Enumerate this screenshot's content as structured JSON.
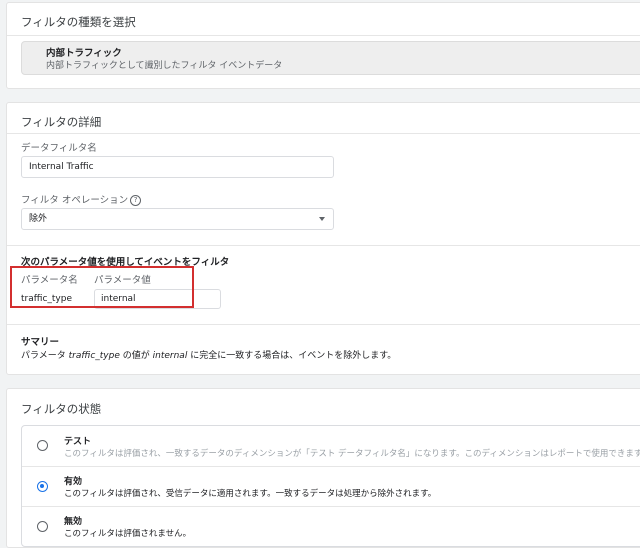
{
  "filter_type_card": {
    "title": "フィルタの種類を選択",
    "selected_type": {
      "name": "内部トラフィック",
      "description": "内部トラフィックとして識別したフィルタ イベントデータ"
    }
  },
  "filter_details_card": {
    "title": "フィルタの詳細",
    "name_label": "データフィルタ名",
    "name_value": "Internal Traffic",
    "operation_label": "フィルタ オペレーション",
    "help_icon": "?",
    "operation_value": "除外",
    "param_section_title": "次のパラメータ値を使用してイベントをフィルタ",
    "param_name_header": "パラメータ名",
    "param_value_header": "パラメータ値",
    "param_name": "traffic_type",
    "param_value": "internal",
    "summary_title": "サマリー",
    "summary_prefix": "パラメータ ",
    "summary_param": "traffic_type",
    "summary_middle": " の値が ",
    "summary_value": "internal",
    "summary_suffix": " に完全に一致する場合は、イベントを除外します。"
  },
  "filter_state_card": {
    "title": "フィルタの状態",
    "options": [
      {
        "label": "テスト",
        "description": "このフィルタは評価され、一致するデータのディメンションが「テスト データフィルタ名」になります。このディメンションはレポートで使用できます。",
        "checked": false
      },
      {
        "label": "有効",
        "description": "このフィルタは評価され、受信データに適用されます。一致するデータは処理から除外されます。",
        "checked": true
      },
      {
        "label": "無効",
        "description": "このフィルタは評価されません。",
        "checked": false
      }
    ]
  },
  "colors": {
    "accent": "#1a73e8",
    "highlight": "#d32f2f",
    "background": "#f1f3f4"
  }
}
